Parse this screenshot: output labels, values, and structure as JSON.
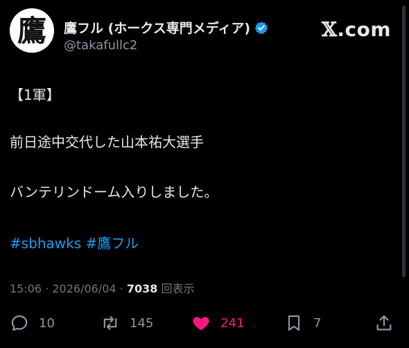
{
  "author": {
    "display_name": "鷹フル (ホークス専門メディア)",
    "handle": "@takafullc2",
    "verified": true,
    "avatar_icon": "taka-kanji-logo-icon",
    "avatar_glyph": "鷹"
  },
  "brand": {
    "x_glyph": "𝕏",
    "label": ".com"
  },
  "post": {
    "line1": "【1軍】",
    "line2": "前日途中交代した山本祐大選手",
    "line3": "バンテリンドーム入りしました。",
    "hashtag1": "#sbhawks",
    "hashtag2": "#鷹フル"
  },
  "meta": {
    "time": "15:06",
    "sep1": " · ",
    "date": "2026/06/04",
    "sep2": " · ",
    "views": "7038",
    "views_label": "回表示"
  },
  "actions": {
    "reply_count": "10",
    "repost_count": "145",
    "like_count": "241",
    "bookmark_count": "7"
  },
  "colors": {
    "background": "#000000",
    "text": "#e7e9ea",
    "secondary": "#71767b",
    "link": "#1d9bf0",
    "like": "#f91880"
  }
}
